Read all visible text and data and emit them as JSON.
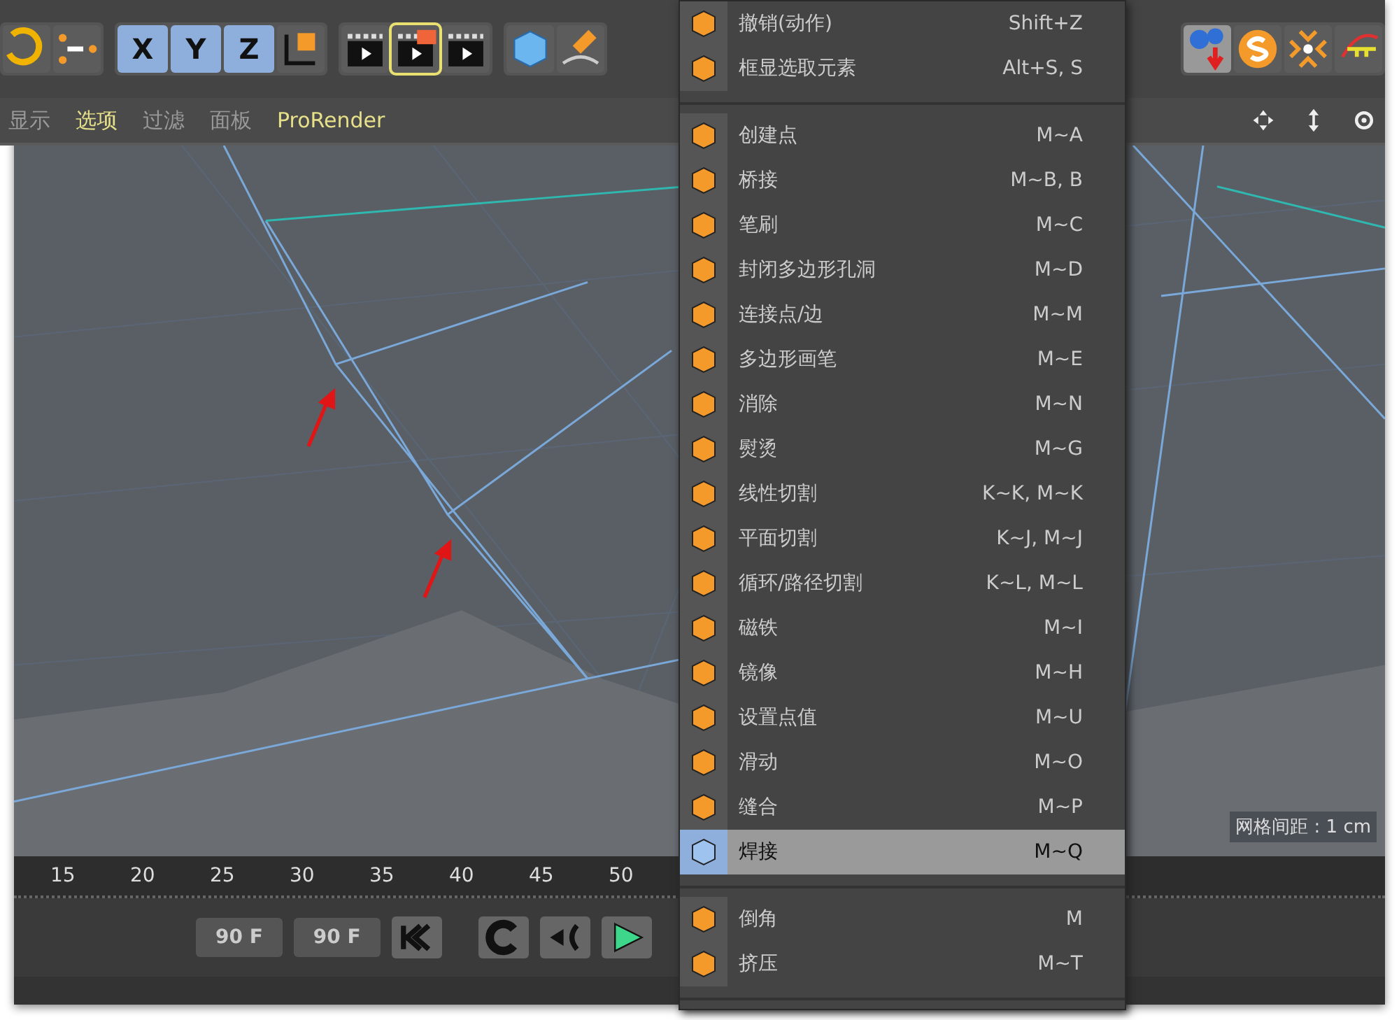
{
  "toolbar": {
    "axis_buttons": [
      {
        "label": "X",
        "selected": true
      },
      {
        "label": "Y",
        "selected": true
      },
      {
        "label": "Z",
        "selected": true
      }
    ]
  },
  "view_menu": [
    {
      "label": "显示",
      "selected": false
    },
    {
      "label": "选项",
      "selected": true
    },
    {
      "label": "过滤",
      "selected": false
    },
    {
      "label": "面板",
      "selected": false
    },
    {
      "label": "ProRender",
      "selected": true
    }
  ],
  "viewport": {
    "grid_spacing": "网格间距 : 1 cm"
  },
  "timeline": {
    "ticks": [
      "15",
      "20",
      "25",
      "30",
      "35",
      "40",
      "45",
      "50"
    ]
  },
  "transport": {
    "start_field": "90 F",
    "end_field": "90 F"
  },
  "context_menu": [
    {
      "kind": "item",
      "label": "撤销(动作)",
      "shortcut": "Shift+Z",
      "selected": false
    },
    {
      "kind": "item",
      "label": "框显选取元素",
      "shortcut": "Alt+S, S",
      "selected": false
    },
    {
      "kind": "divider"
    },
    {
      "kind": "item",
      "label": "创建点",
      "shortcut": "M~A",
      "selected": false
    },
    {
      "kind": "item",
      "label": "桥接",
      "shortcut": "M~B, B",
      "selected": false
    },
    {
      "kind": "item",
      "label": "笔刷",
      "shortcut": "M~C",
      "selected": false
    },
    {
      "kind": "item",
      "label": "封闭多边形孔洞",
      "shortcut": "M~D",
      "selected": false
    },
    {
      "kind": "item",
      "label": "连接点/边",
      "shortcut": "M~M",
      "selected": false
    },
    {
      "kind": "item",
      "label": "多边形画笔",
      "shortcut": "M~E",
      "selected": false
    },
    {
      "kind": "item",
      "label": "消除",
      "shortcut": "M~N",
      "selected": false
    },
    {
      "kind": "item",
      "label": "熨烫",
      "shortcut": "M~G",
      "selected": false
    },
    {
      "kind": "item",
      "label": "线性切割",
      "shortcut": "K~K, M~K",
      "selected": false
    },
    {
      "kind": "item",
      "label": "平面切割",
      "shortcut": "K~J, M~J",
      "selected": false
    },
    {
      "kind": "item",
      "label": "循环/路径切割",
      "shortcut": "K~L, M~L",
      "selected": false
    },
    {
      "kind": "item",
      "label": "磁铁",
      "shortcut": "M~I",
      "selected": false
    },
    {
      "kind": "item",
      "label": "镜像",
      "shortcut": "M~H",
      "selected": false
    },
    {
      "kind": "item",
      "label": "设置点值",
      "shortcut": "M~U",
      "selected": false
    },
    {
      "kind": "item",
      "label": "滑动",
      "shortcut": "M~O",
      "selected": false
    },
    {
      "kind": "item",
      "label": "缝合",
      "shortcut": "M~P",
      "selected": false
    },
    {
      "kind": "item",
      "label": "焊接",
      "shortcut": "M~Q",
      "selected": true
    },
    {
      "kind": "divider"
    },
    {
      "kind": "item",
      "label": "倒角",
      "shortcut": "M",
      "selected": false
    },
    {
      "kind": "item",
      "label": "挤压",
      "shortcut": "M~T",
      "selected": false
    },
    {
      "kind": "divider"
    }
  ]
}
